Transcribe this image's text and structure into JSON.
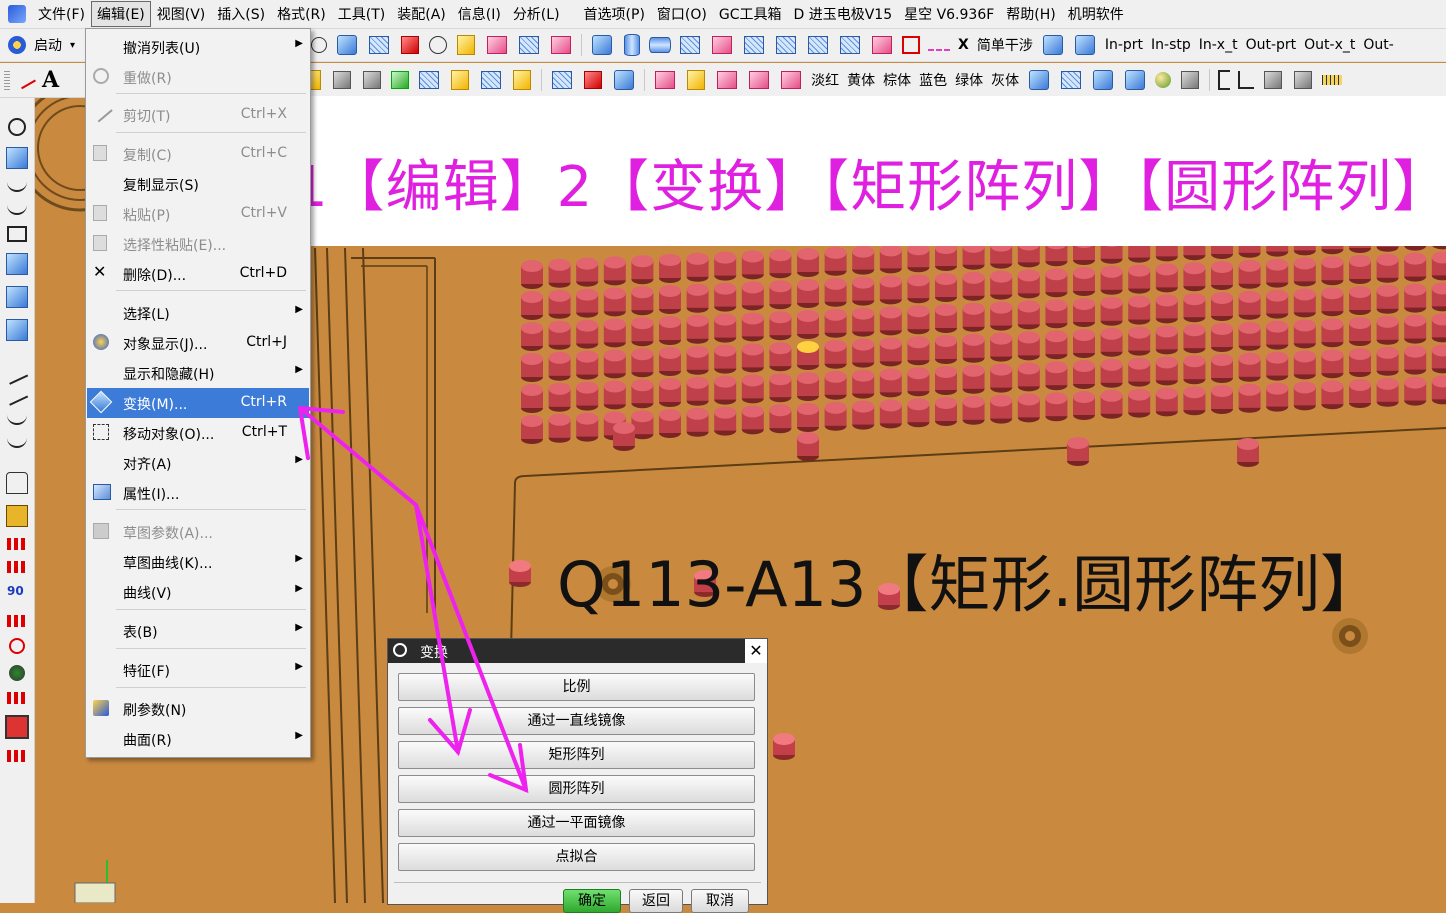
{
  "menubar": {
    "items": [
      "文件(F)",
      "编辑(E)",
      "视图(V)",
      "插入(S)",
      "格式(R)",
      "工具(T)",
      "装配(A)",
      "信息(I)",
      "分析(L)",
      "首选项(P)",
      "窗口(O)",
      "GC工具箱",
      "D 进玉电极V15",
      "星空 V6.936F",
      "帮助(H)",
      "机明软件"
    ]
  },
  "toolbar1": {
    "start_label": "启动",
    "simple_interference": "简单干涉",
    "file_buttons": [
      "In-prt",
      "In-stp",
      "In-x_t",
      "Out-prt",
      "Out-x_t",
      "Out-"
    ]
  },
  "toolbar2": {
    "colors": [
      "淡红",
      "黄体",
      "棕体",
      "蓝色",
      "绿体",
      "灰体"
    ]
  },
  "edit_menu": {
    "items": [
      {
        "label": "撤消列表(U)",
        "shortcut": "",
        "submenu": true,
        "disabled": false
      },
      {
        "label": "重做(R)",
        "shortcut": "",
        "submenu": false,
        "disabled": true
      },
      {
        "label": "剪切(T)",
        "shortcut": "Ctrl+X",
        "submenu": false,
        "disabled": true
      },
      {
        "label": "复制(C)",
        "shortcut": "Ctrl+C",
        "submenu": false,
        "disabled": true
      },
      {
        "label": "复制显示(S)",
        "shortcut": "",
        "submenu": false,
        "disabled": false
      },
      {
        "label": "粘贴(P)",
        "shortcut": "Ctrl+V",
        "submenu": false,
        "disabled": true
      },
      {
        "label": "选择性粘贴(E)...",
        "shortcut": "",
        "submenu": false,
        "disabled": true
      },
      {
        "label": "删除(D)...",
        "shortcut": "Ctrl+D",
        "submenu": false,
        "disabled": false
      },
      {
        "label": "选择(L)",
        "shortcut": "",
        "submenu": true,
        "disabled": false
      },
      {
        "label": "对象显示(J)...",
        "shortcut": "Ctrl+J",
        "submenu": false,
        "disabled": false
      },
      {
        "label": "显示和隐藏(H)",
        "shortcut": "",
        "submenu": true,
        "disabled": false
      },
      {
        "label": "变换(M)...",
        "shortcut": "Ctrl+R",
        "submenu": false,
        "disabled": false,
        "highlighted": true
      },
      {
        "label": "移动对象(O)...",
        "shortcut": "Ctrl+T",
        "submenu": false,
        "disabled": false
      },
      {
        "label": "对齐(A)",
        "shortcut": "",
        "submenu": true,
        "disabled": false
      },
      {
        "label": "属性(I)...",
        "shortcut": "",
        "submenu": false,
        "disabled": false
      },
      {
        "label": "草图参数(A)...",
        "shortcut": "",
        "submenu": false,
        "disabled": true
      },
      {
        "label": "草图曲线(K)...",
        "shortcut": "",
        "submenu": true,
        "disabled": false
      },
      {
        "label": "曲线(V)",
        "shortcut": "",
        "submenu": true,
        "disabled": false
      },
      {
        "label": "表(B)",
        "shortcut": "",
        "submenu": true,
        "disabled": false
      },
      {
        "label": "特征(F)",
        "shortcut": "",
        "submenu": true,
        "disabled": false
      },
      {
        "label": "刷参数(N)",
        "shortcut": "",
        "submenu": false,
        "disabled": false
      },
      {
        "label": "曲面(R)",
        "shortcut": "",
        "submenu": true,
        "disabled": false
      }
    ]
  },
  "annotation": {
    "banner": "1【编辑】2【变换】【矩形阵列】【圆形阵列】",
    "model_label": "Q113-A13【矩形.圆形阵列】"
  },
  "dialog": {
    "title": "变换",
    "buttons": [
      "比例",
      "通过一直线镜像",
      "矩形阵列",
      "圆形阵列",
      "通过一平面镜像",
      "点拟合"
    ],
    "footer": {
      "ok": "确定",
      "back": "返回",
      "cancel": "取消"
    }
  },
  "colors": {
    "canvas": "#c98a40",
    "pin": "#e2646e",
    "annotation": "#e020e0",
    "highlight": "#3d7bd9",
    "ok_button": "#33b533"
  }
}
